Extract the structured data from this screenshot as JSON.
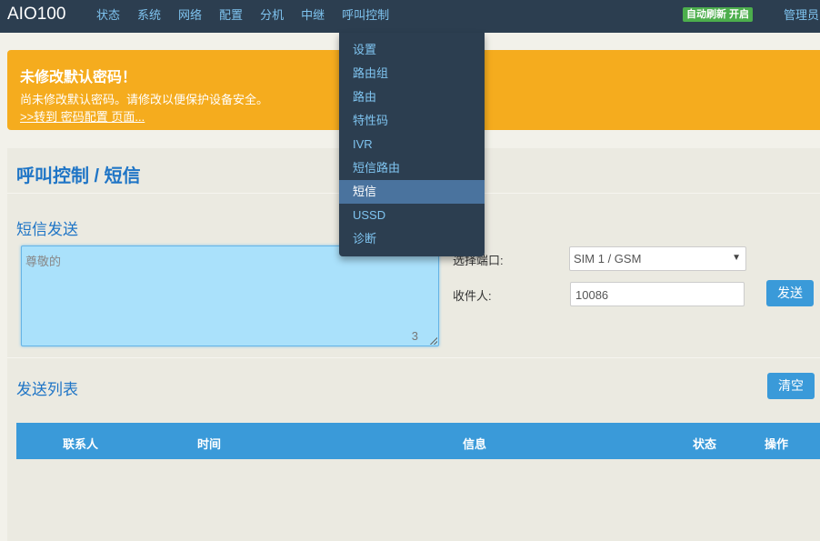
{
  "brand": "AIO100",
  "nav": {
    "items": [
      "状态",
      "系统",
      "网络",
      "配置",
      "分机",
      "中继",
      "呼叫控制"
    ],
    "auto_refresh": "自动刷新 开启",
    "admin": "管理员"
  },
  "alert": {
    "title": "未修改默认密码！",
    "text": "尚未修改默认密码。请修改以便保护设备安全。",
    "link": ">>转到 密码配置 页面..."
  },
  "page": {
    "title": "呼叫控制 / 短信",
    "send_section": "短信发送",
    "message_placeholder": "尊敬的",
    "char_count": "3",
    "port_label": "选择端口:",
    "port_value": "SIM 1 / GSM",
    "recipient_label": "收件人:",
    "recipient_value": "10086",
    "send_button": "发送",
    "list_section": "发送列表",
    "clear_button": "清空",
    "table_headers": [
      "联系人",
      "时间",
      "信息",
      "状态",
      "操作"
    ]
  },
  "dropdown": {
    "items": [
      "设置",
      "路由组",
      "路由",
      "特性码",
      "IVR",
      "短信路由",
      "短信",
      "USSD",
      "诊断"
    ],
    "active": "短信"
  },
  "colors": {
    "navbar": "#2c3e50",
    "link": "#7fc4f0",
    "accent": "#3a9ad9",
    "warning": "#f5ac1e",
    "success": "#4cae4c",
    "title": "#1f75c6"
  }
}
